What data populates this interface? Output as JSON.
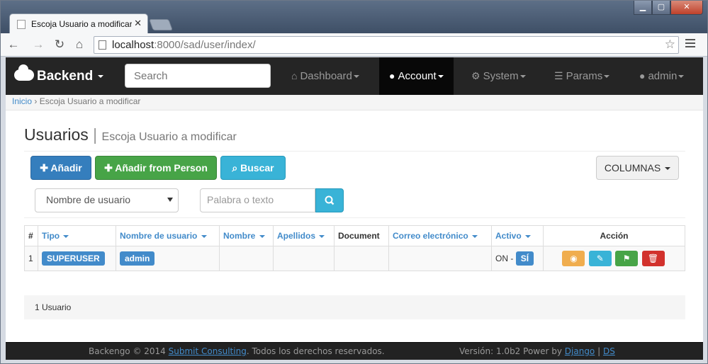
{
  "browser": {
    "tab_title": "Escoja Usuario a modificar",
    "url_host": "localhost",
    "url_rest": ":8000/sad/user/index/"
  },
  "navbar": {
    "brand": "Backend",
    "search_placeholder": "Search",
    "items": [
      {
        "label": "Dashboard",
        "icon": "home-icon"
      },
      {
        "label": "Account",
        "icon": "user-icon"
      },
      {
        "label": "System",
        "icon": "cogs-icon"
      },
      {
        "label": "Params",
        "icon": "list-icon"
      },
      {
        "label": "admin",
        "icon": "user-icon"
      }
    ]
  },
  "breadcrumb": {
    "home": "Inicio",
    "sep": "›",
    "current": "Escoja Usuario a modificar"
  },
  "header": {
    "title": "Usuarios",
    "subtitle": "Escoja Usuario a modificar"
  },
  "actions": {
    "add": "Añadir",
    "add_person": "Añadir from Person",
    "search": "Buscar",
    "columns": "COLUMNAS"
  },
  "filter": {
    "select_value": "Nombre de usuario",
    "text_placeholder": "Palabra o texto"
  },
  "table": {
    "headers": [
      "#",
      "Tipo",
      "Nombre de usuario",
      "Nombre",
      "Apellidos",
      "Document",
      "Correo electrónico",
      "Activo",
      "Acción"
    ],
    "rows": [
      {
        "num": "1",
        "tipo": "SUPERUSER",
        "username": "admin",
        "nombre": "",
        "apellidos": "",
        "document": "",
        "correo": "",
        "activo_text": "ON -",
        "activo_badge": "SÍ"
      }
    ]
  },
  "summary": "1 Usuario",
  "footer": {
    "left_pre": "Backengo © 2014",
    "left_link": "Submit Consulting",
    "left_post": ". Todos los derechos reservados.",
    "right_pre": "Versión: 1.0b2 Power by",
    "link1": "Django",
    "sep": "|",
    "link2": "DS"
  },
  "colors": {
    "primary": "#428bca",
    "success": "#47a447",
    "info": "#39b3d7",
    "warning": "#f0ad4e",
    "danger": "#d2322d",
    "navbar": "#252525"
  }
}
